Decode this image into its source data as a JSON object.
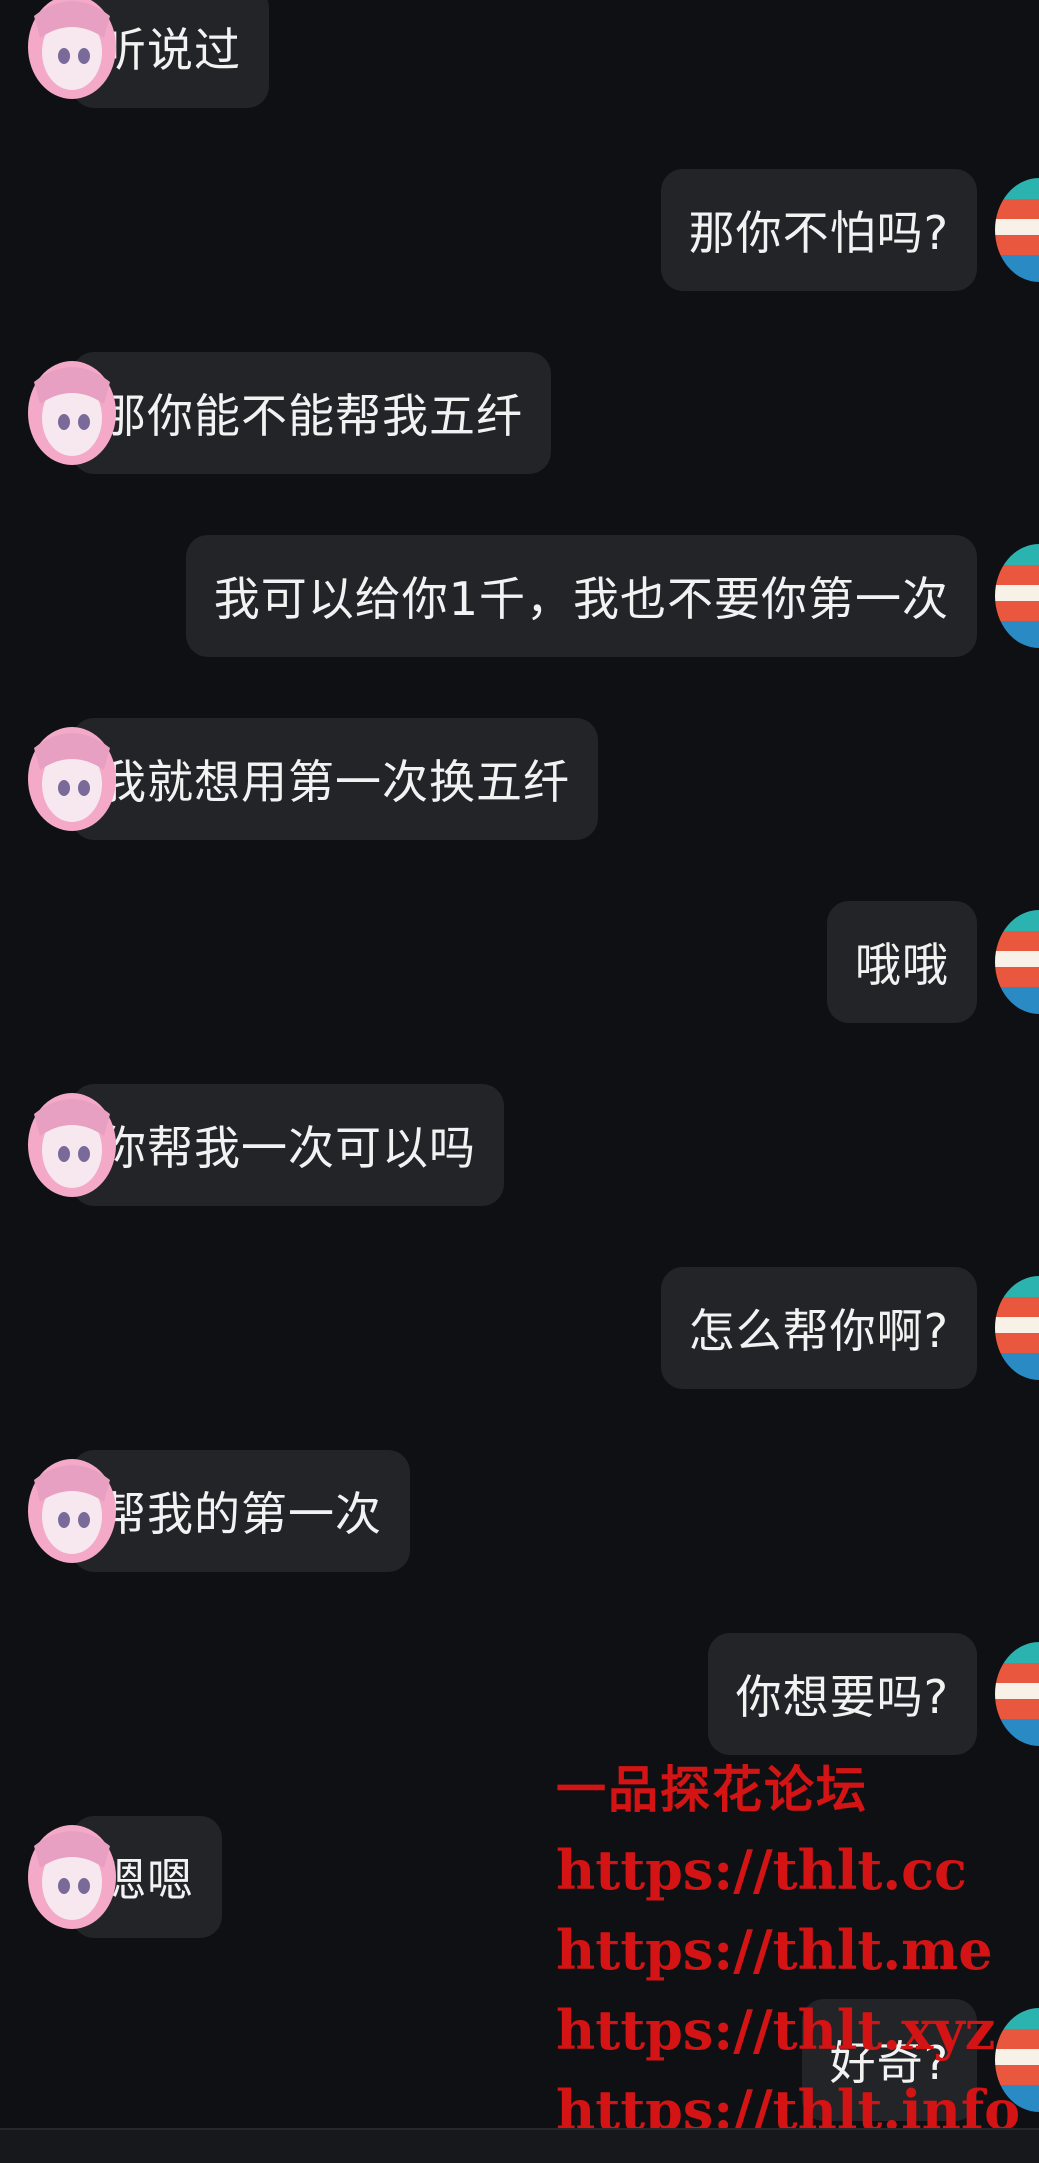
{
  "messages": [
    {
      "side": "left",
      "text": "听说过"
    },
    {
      "side": "right",
      "text": "那你不怕吗?"
    },
    {
      "side": "left",
      "text": "那你能不能帮我五纤"
    },
    {
      "side": "right",
      "text": "我可以给你1千，我也不要你第一次"
    },
    {
      "side": "left",
      "text": "我就想用第一次换五纤"
    },
    {
      "side": "right",
      "text": "哦哦"
    },
    {
      "side": "left",
      "text": "你帮我一次可以吗"
    },
    {
      "side": "right",
      "text": "怎么帮你啊?"
    },
    {
      "side": "left",
      "text": "帮我的第一次"
    },
    {
      "side": "right",
      "text": "你想要吗?"
    },
    {
      "side": "left",
      "text": "嗯嗯"
    },
    {
      "side": "right",
      "text": "好奇?"
    }
  ],
  "watermark": {
    "title": "一品探花论坛",
    "urls": [
      "https://thlt.cc",
      "https://thlt.me",
      "https://thlt.xyz",
      "https://thlt.info"
    ]
  },
  "colors": {
    "background": "#0f1013",
    "bubble": "#232427",
    "text": "#f2f2f2",
    "watermark": "#d41414"
  },
  "icons": {
    "left_avatar": "anime-girl-avatar",
    "right_avatar": "striped-avatar"
  }
}
